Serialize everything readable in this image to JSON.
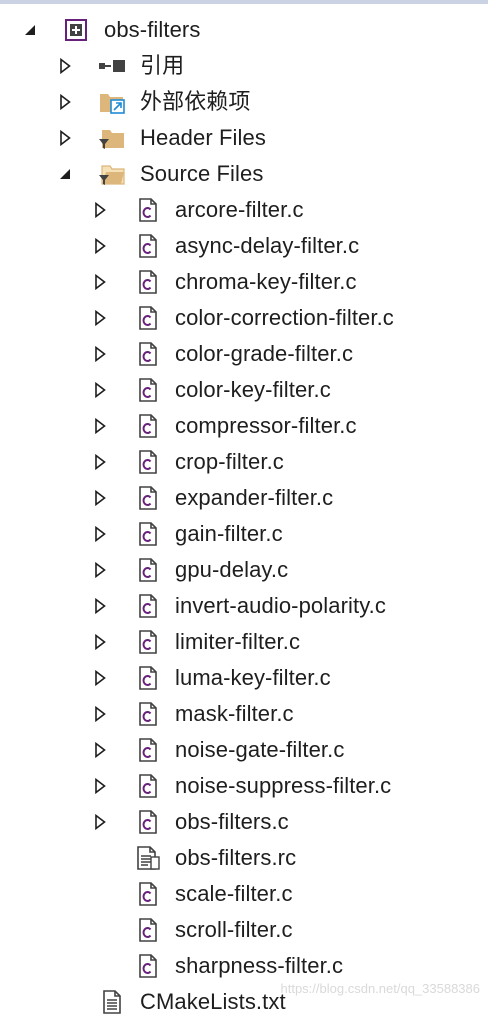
{
  "project": {
    "name": "obs-filters"
  },
  "nodes": {
    "references": "引用",
    "external_deps": "外部依赖项",
    "header_files": "Header Files",
    "source_files": "Source Files"
  },
  "source_files": [
    "arcore-filter.c",
    "async-delay-filter.c",
    "chroma-key-filter.c",
    "color-correction-filter.c",
    "color-grade-filter.c",
    "color-key-filter.c",
    "compressor-filter.c",
    "crop-filter.c",
    "expander-filter.c",
    "gain-filter.c",
    "gpu-delay.c",
    "invert-audio-polarity.c",
    "limiter-filter.c",
    "luma-key-filter.c",
    "mask-filter.c",
    "noise-gate-filter.c",
    "noise-suppress-filter.c",
    "obs-filters.c"
  ],
  "rc_file": "obs-filters.rc",
  "leaf_files": [
    "scale-filter.c",
    "scroll-filter.c",
    "sharpness-filter.c"
  ],
  "root_file": "CMakeLists.txt",
  "watermark": "https://blog.csdn.net/qq_33588386",
  "icons": {
    "expanded": "triangle-down-filled",
    "collapsed": "triangle-right-outline",
    "c_file": "c-source-file",
    "folder": "filter-folder"
  },
  "colors": {
    "text": "#1e1e1e",
    "arrow": "#1e1e1e",
    "c_accent": "#68217a",
    "folder": "#dcb67a",
    "ext_badge": "#1e8bd6"
  }
}
